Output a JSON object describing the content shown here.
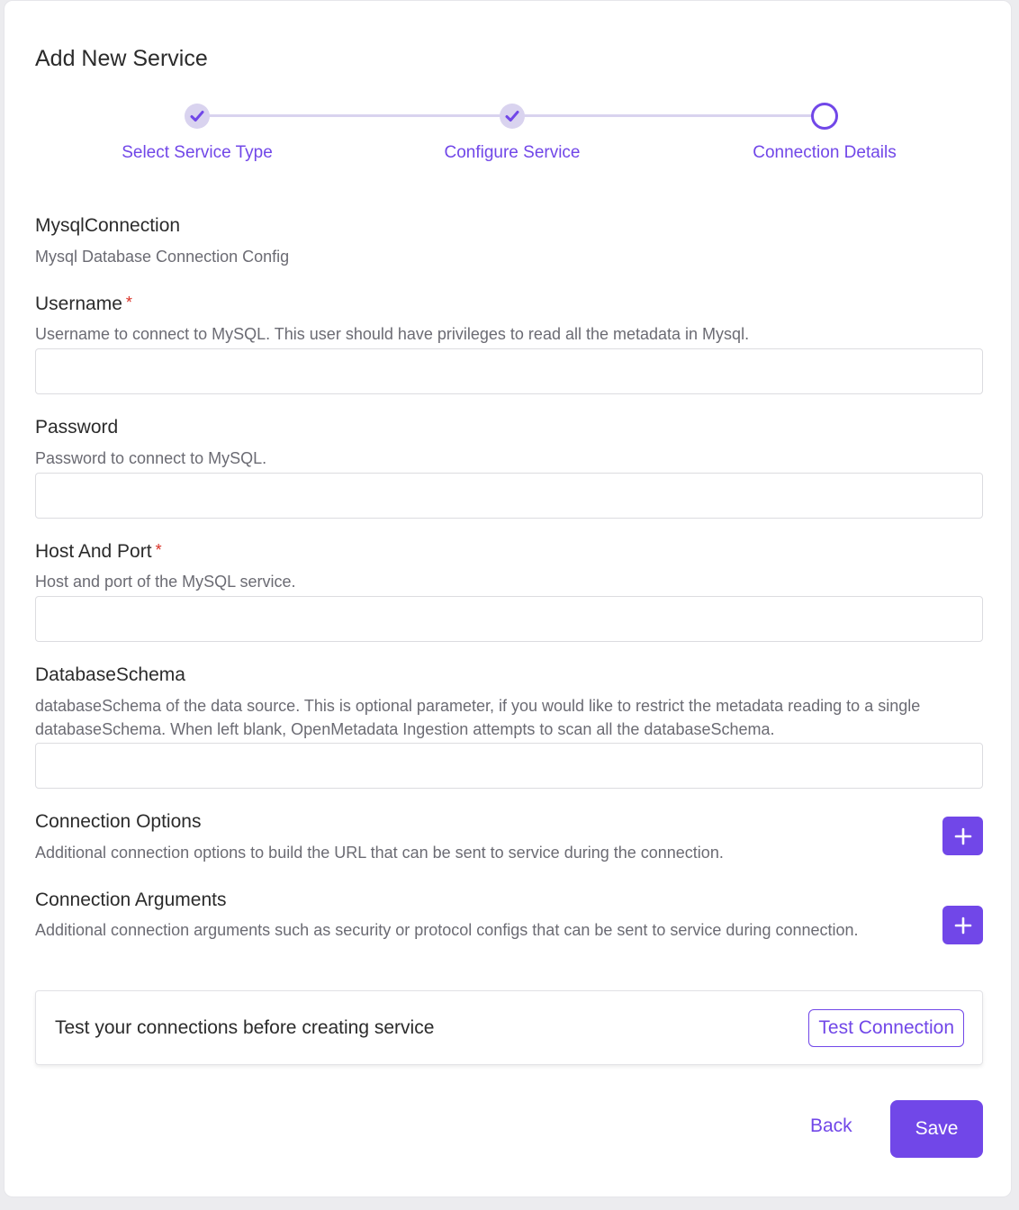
{
  "header": {
    "title": "Add New Service"
  },
  "stepper": {
    "steps": [
      {
        "label": "Select Service Type",
        "state": "done"
      },
      {
        "label": "Configure Service",
        "state": "done"
      },
      {
        "label": "Connection Details",
        "state": "current"
      }
    ],
    "accent": "#7147e8",
    "track_color": "#d9d3ef"
  },
  "section": {
    "title": "MysqlConnection",
    "description": "Mysql Database Connection Config"
  },
  "fields": [
    {
      "label": "Username",
      "required": true,
      "description": "Username to connect to MySQL. This user should have privileges to read all the metadata in Mysql.",
      "value": ""
    },
    {
      "label": "Password",
      "required": false,
      "description": "Password to connect to MySQL.",
      "value": ""
    },
    {
      "label": "Host And Port",
      "required": true,
      "description": "Host and port of the MySQL service.",
      "value": ""
    },
    {
      "label": "DatabaseSchema",
      "required": false,
      "description": "databaseSchema of the data source. This is optional parameter, if you would like to restrict the metadata reading to a single databaseSchema. When left blank, OpenMetadata Ingestion attempts to scan all the databaseSchema.",
      "value": ""
    }
  ],
  "options": [
    {
      "label": "Connection Options",
      "description": "Additional connection options to build the URL that can be sent to service during the connection.",
      "button_icon": "plus-icon"
    },
    {
      "label": "Connection Arguments",
      "description": "Additional connection arguments such as security or protocol configs that can be sent to service during connection.",
      "button_icon": "plus-icon"
    }
  ],
  "test_connection": {
    "message": "Test your connections before creating service",
    "button_label": "Test Connection"
  },
  "footer": {
    "back_label": "Back",
    "save_label": "Save"
  },
  "required_marker": "*"
}
